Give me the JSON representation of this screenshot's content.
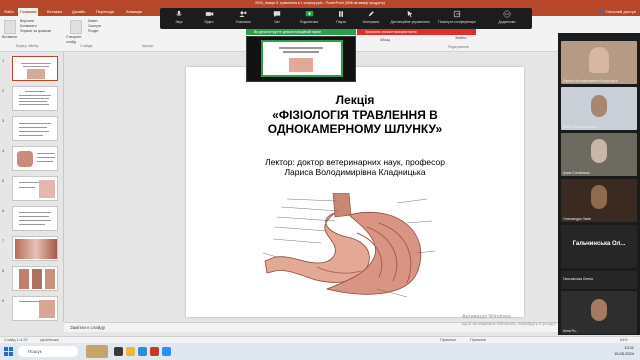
{
  "window": {
    "title": "2024_лекція 5. травлення в 1 шлунку.pptx  -  PowerPoint (Збій активації продукту)"
  },
  "ribbon_tabs": [
    "Файл",
    "Головна",
    "Вставка",
    "Дизайн",
    "Переходи",
    "Анімація"
  ],
  "share_label": "Спільний доступ",
  "ribbon": {
    "paste": "Вставити",
    "clipboard_items": [
      "Вирізати",
      "Копіювати",
      "Формат за зразком"
    ],
    "clipboard_label": "Буфер обміну",
    "new_slide": "Створити слайд",
    "slides_items": [
      "Макет",
      "Скинути",
      "Розділ"
    ],
    "slides_label": "Слайди",
    "font_label": "Шрифт",
    "find": "Знайти",
    "replace": "Замінити",
    "select": "Виділити",
    "editing_label": "Редагування",
    "paragraph_tail": "Абзац"
  },
  "thumbnails": [
    {
      "num": "1"
    },
    {
      "num": "2"
    },
    {
      "num": "3"
    },
    {
      "num": "4"
    },
    {
      "num": "5"
    },
    {
      "num": "6"
    },
    {
      "num": "7"
    },
    {
      "num": "8"
    },
    {
      "num": "9"
    }
  ],
  "slide": {
    "line1": "Лекція",
    "line2": "«ФІЗІОЛОГІЯ ТРАВЛЕННЯ В",
    "line3": "ОДНОКАМЕРНОМУ ШЛУНКУ»",
    "line4": "Лектор: доктор ветеринарних наук, професор",
    "line5": "Лариса Володимирівна Кладницька"
  },
  "notes_placeholder": "Замітки к слайду",
  "watermark": {
    "line1": "Активація Windows",
    "line2": "Щоб активувати Windows, перейдіть в розділ \"Параметри\""
  },
  "status": {
    "slide_info": "Слайд 1 із 29",
    "language": "українська",
    "notes": "Примітки",
    "comments": "Примітки",
    "zoom": "64%"
  },
  "taskbar": {
    "search_placeholder": "Пошук",
    "time": "13:11",
    "date": "15.05.2024"
  },
  "zoom": {
    "toolbar": [
      "Звук",
      "Відео",
      "Учасники",
      "Чат",
      "Поділитися",
      "Пауза",
      "Анотувати",
      "Дистанційне управління",
      "Покинути конференцію",
      "Додатково"
    ],
    "sharing_banner": "Ви демонструєте демонстраційний екран",
    "stop_banner": "Зупинити спільне використання",
    "accent_green": "#2e9e4e",
    "accent_red": "#d9312b"
  },
  "participants": [
    {
      "name": "Лариса Володимирівна Кладницька"
    },
    {
      "name": "Вайс Ніколай Іванович"
    },
    {
      "name": "Ірина Степанівна"
    },
    {
      "name": "Олександра Львів"
    },
    {
      "name": "Гальчинська Ол..."
    },
    {
      "name": "Гальчинська Олена"
    },
    {
      "name": "Анна Ро..."
    }
  ]
}
